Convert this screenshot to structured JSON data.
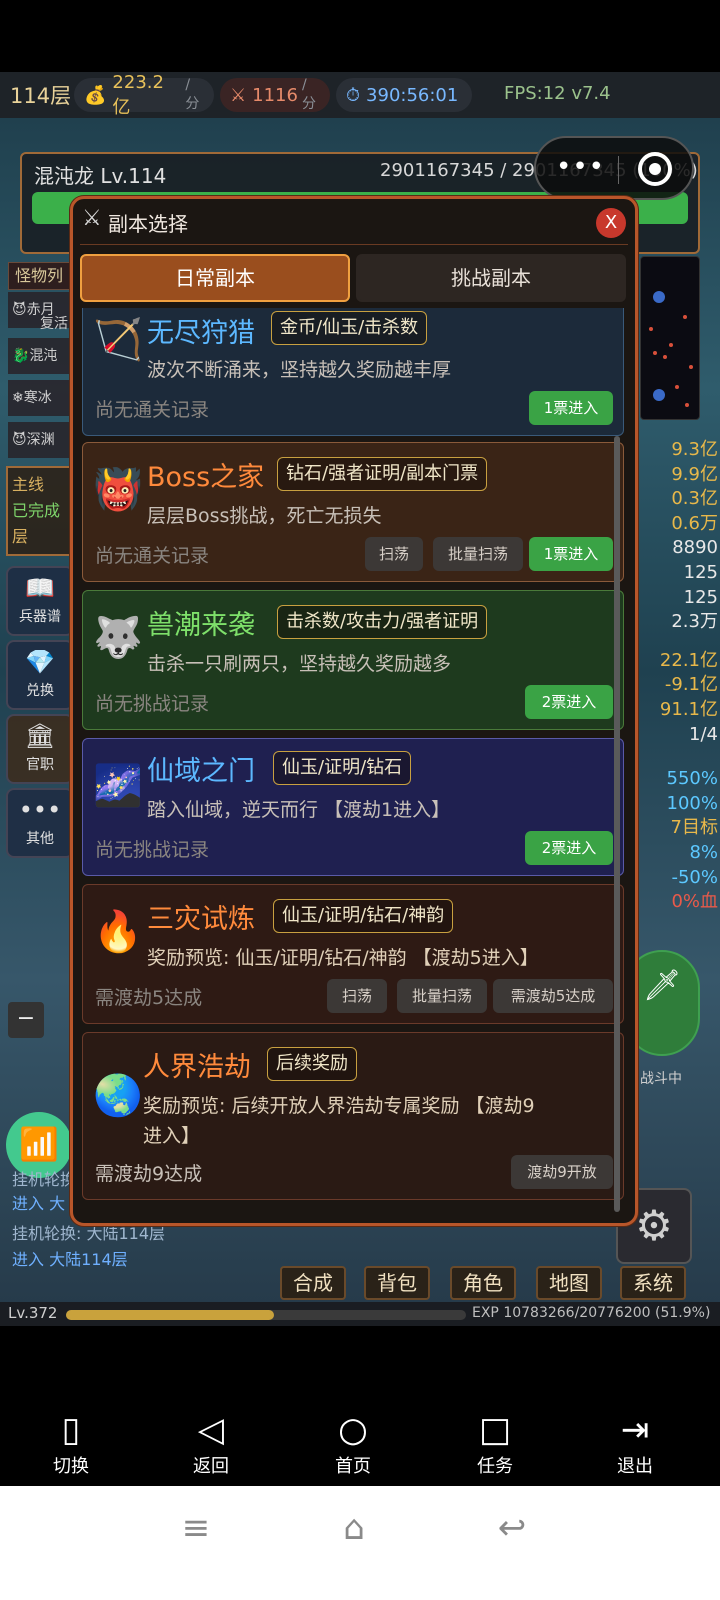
{
  "topbar": {
    "floor": "114层",
    "gold": {
      "value": "223.2亿",
      "unit": "/分"
    },
    "attack": {
      "value": "1116",
      "unit": "/分"
    },
    "time": "390:56:01",
    "fps": "FPS:12 v7.4"
  },
  "boss": {
    "name": "混沌龙 Lv.114",
    "hp": "2901167345 / 2901167345 (100%)"
  },
  "left_panel": {
    "monster_label": "怪物列",
    "monsters": [
      "赤月",
      "复活",
      "混沌",
      "寒冰",
      "深渊"
    ],
    "quest_title": "主线",
    "quest_status": "已完成",
    "quest_suffix": "层",
    "buttons": [
      "兵器谱",
      "兑换",
      "官职",
      "其他"
    ]
  },
  "right_stats": [
    "9.3亿",
    "9.9亿",
    "0.3亿",
    "0.6万",
    "8890",
    "125",
    "125",
    "2.3万",
    "22.1亿",
    "-9.1亿",
    "91.1亿",
    "1/4",
    "550%",
    "100%",
    "7目标",
    "8%",
    "-50%",
    "0%血"
  ],
  "battle_text": "战斗中",
  "log": {
    "line1_label": "挂机轮换:",
    "line1_enter": "进入 大",
    "line2_label": "挂机轮换: 大陆114层",
    "line2_enter": "进入 大陆114层"
  },
  "dock": [
    "合成",
    "背包",
    "角色",
    "地图",
    "系统"
  ],
  "level": {
    "label": "Lv.372",
    "exp": "EXP 10783266/20776200 (51.9%)",
    "progress": 0.519
  },
  "dialog": {
    "title": "副本选择",
    "close": "X",
    "tabs": [
      "日常副本",
      "挑战副本"
    ],
    "cards": [
      {
        "icon": "🏹",
        "title": "无尽狩猎",
        "tag": "金币/仙玉/击杀数",
        "desc": "波次不断涌来，坚持越久奖励越丰厚",
        "record": "尚无通关记录",
        "buttons": [
          "1票进入"
        ]
      },
      {
        "icon": "👹",
        "title": "Boss之家",
        "tag": "钻石/强者证明/副本门票",
        "desc": "层层Boss挑战，死亡无损失",
        "record": "尚无通关记录",
        "buttons": [
          "扫荡",
          "批量扫荡",
          "1票进入"
        ]
      },
      {
        "icon": "🐺",
        "title": "兽潮来袭",
        "tag": "击杀数/攻击力/强者证明",
        "desc": "击杀一只刷两只，坚持越久奖励越多",
        "record": "尚无挑战记录",
        "buttons": [
          "2票进入"
        ]
      },
      {
        "icon": "🌌",
        "title": "仙域之门",
        "tag": "仙玉/证明/钻石",
        "desc": "踏入仙域，逆天而行 【渡劫1进入】",
        "record": "尚无挑战记录",
        "buttons": [
          "2票进入"
        ]
      },
      {
        "icon": "🔥",
        "title": "三灾试炼",
        "tag": "仙玉/证明/钻石/神韵",
        "desc": "奖励预览: 仙玉/证明/钻石/神韵 【渡劫5进入】",
        "record": "需渡劫5达成",
        "buttons": [
          "扫荡",
          "批量扫荡",
          "需渡劫5达成"
        ]
      },
      {
        "icon": "🌏",
        "title": "人界浩劫",
        "tag": "后续奖励",
        "desc_line1": "奖励预览: 后续开放人界浩劫专属奖励 【渡劫9",
        "desc_line2": "进入】",
        "record": "需渡劫9达成",
        "buttons": [
          "渡劫9开放"
        ]
      }
    ]
  },
  "nav": [
    "切换",
    "返回",
    "首页",
    "任务",
    "退出"
  ],
  "colors": {
    "dialog_border": "#b8562a",
    "tab_active": "#9a4e1e",
    "enter_button": "#3aa345",
    "title_blue": "#5cb8ff",
    "title_orange": "#ff8a3c",
    "title_green": "#7ee06a"
  }
}
